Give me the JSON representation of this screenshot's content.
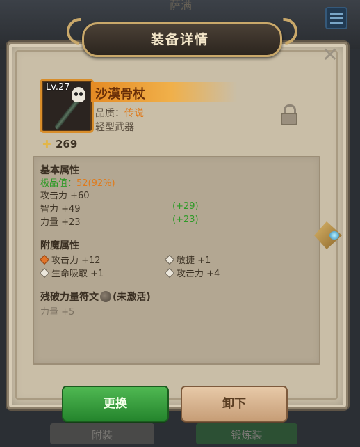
{
  "background": {
    "title_ghost": "萨满"
  },
  "dialog": {
    "title": "装备详情",
    "close_symbol": "✕"
  },
  "item": {
    "level": "Lv.27",
    "name": "沙漠骨杖",
    "quality_label": "品质：",
    "quality_value": "传说",
    "type": "轻型武器",
    "power": "269",
    "icon": "bone-staff-icon",
    "quality_color": "#e07a1a"
  },
  "basic": {
    "title": "基本属性",
    "grade_label": "极品值：",
    "grade_value": "52(92%)",
    "attack": "攻击力 +60",
    "intelligence": "智力 +49",
    "intelligence_bonus": "(+29)",
    "strength": "力量 +23",
    "strength_bonus": "(+23)"
  },
  "enchant": {
    "title": "附魔属性",
    "items": [
      "攻击力 +12",
      "敏捷 +1",
      "生命吸取 +1",
      "攻击力 +4"
    ]
  },
  "rune": {
    "title": "残破力量符文",
    "status": "(未激活)",
    "stat": "力量 +5"
  },
  "buttons": {
    "replace": "更换",
    "unequip": "卸下",
    "ghost_left": "附装",
    "ghost_right": "锻炼装"
  },
  "colors": {
    "accent_green": "#2e9a27",
    "accent_orange": "#e07a1a",
    "button_green": "#25852d"
  }
}
